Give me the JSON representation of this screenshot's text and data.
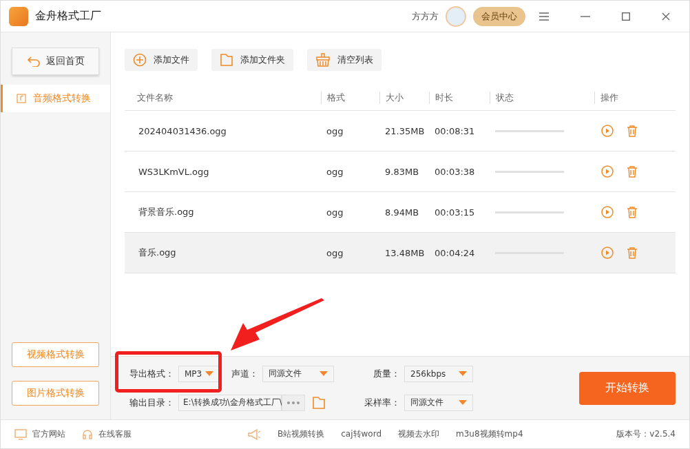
{
  "window": {
    "title": "金舟格式工厂",
    "user": "方方方",
    "vip": "会员中心"
  },
  "sidebar": {
    "back": "返回首页",
    "items": [
      {
        "label": "音频格式转换",
        "selected": true
      }
    ],
    "bottom_buttons": [
      "视频格式转换",
      "图片格式转换"
    ]
  },
  "toolbar": [
    {
      "kind": "add",
      "label": "添加文件"
    },
    {
      "kind": "folder",
      "label": "添加文件夹"
    },
    {
      "kind": "clear",
      "label": "清空列表"
    }
  ],
  "table": {
    "columns": [
      "文件名称",
      "格式",
      "大小",
      "时长",
      "状态",
      "操作"
    ],
    "rows": [
      {
        "name": "202404031436.ogg",
        "format": "ogg",
        "size": "21.35MB",
        "duration": "00:08:31",
        "selected": false
      },
      {
        "name": "WS3LKmVL.ogg",
        "format": "ogg",
        "size": "9.83MB",
        "duration": "00:03:38",
        "selected": false
      },
      {
        "name": "背景音乐.ogg",
        "format": "ogg",
        "size": "8.94MB",
        "duration": "00:03:15",
        "selected": false
      },
      {
        "name": "音乐.ogg",
        "format": "ogg",
        "size": "13.48MB",
        "duration": "00:04:24",
        "selected": true
      }
    ]
  },
  "settings": {
    "export_format": {
      "label": "导出格式：",
      "value": "MP3"
    },
    "channel": {
      "label": "声道：",
      "value": "同源文件"
    },
    "quality": {
      "label": "质量：",
      "value": "256kbps"
    },
    "output_dir": {
      "label": "输出目录：",
      "value": "E:\\转换成功\\金舟格式工厂\\"
    },
    "sample_rate": {
      "label": "采样率：",
      "value": "同源文件"
    },
    "start": "开始转换"
  },
  "footer": {
    "links": [
      "官方网站",
      "在线客服"
    ],
    "promos": [
      "B站视频转换",
      "caj转word",
      "视频去水印",
      "m3u8视频转mp4"
    ],
    "version": "版本号：v2.5.4"
  }
}
